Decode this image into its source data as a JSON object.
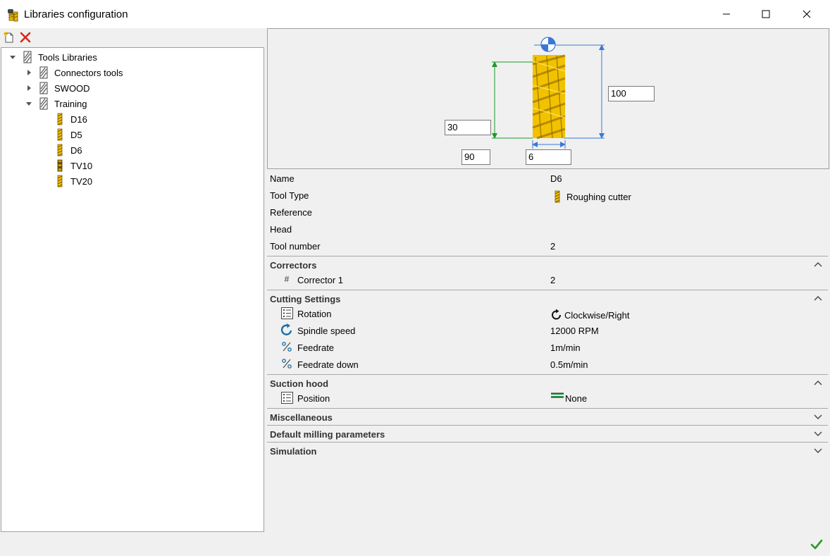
{
  "window": {
    "title": "Libraries configuration"
  },
  "toolbar": {
    "new_icon": "new-document-icon",
    "delete_icon": "delete-icon"
  },
  "tree": {
    "root": "Tools Libraries",
    "libraries": [
      {
        "label": "Connectors tools",
        "expanded": false
      },
      {
        "label": "SWOOD",
        "expanded": false
      },
      {
        "label": "Training",
        "expanded": true
      }
    ],
    "tools": [
      "D16",
      "D5",
      "D6",
      "TV10",
      "TV20"
    ]
  },
  "preview": {
    "dim_length": "100",
    "dim_cut_length": "30",
    "dim_angle": "90",
    "dim_diameter": "6"
  },
  "properties": {
    "name_label": "Name",
    "name_value": "D6",
    "tool_type_label": "Tool Type",
    "tool_type_value": "Roughing cutter",
    "reference_label": "Reference",
    "head_label": "Head",
    "tool_number_label": "Tool number",
    "tool_number_value": "2"
  },
  "sections": {
    "correctors": {
      "title": "Correctors",
      "corrector_label": "Corrector 1",
      "corrector_value": "2"
    },
    "cutting": {
      "title": "Cutting Settings",
      "rotation_label": "Rotation",
      "rotation_value": "Clockwise/Right",
      "spindle_label": "Spindle speed",
      "spindle_value": "12000 RPM",
      "feedrate_label": "Feedrate",
      "feedrate_value": "1m/min",
      "feedrate_down_label": "Feedrate down",
      "feedrate_down_value": "0.5m/min"
    },
    "suction": {
      "title": "Suction hood",
      "position_label": "Position",
      "position_value": "None"
    },
    "misc": {
      "title": "Miscellaneous"
    },
    "milling": {
      "title": "Default milling parameters"
    },
    "simulation": {
      "title": "Simulation"
    }
  },
  "colors": {
    "dim_blue": "#3a78d8",
    "dim_green": "#1a9a2a",
    "tool_yellow": "#f2c200",
    "ok_green": "#2a9a2a",
    "delete_red": "#d9261c"
  }
}
